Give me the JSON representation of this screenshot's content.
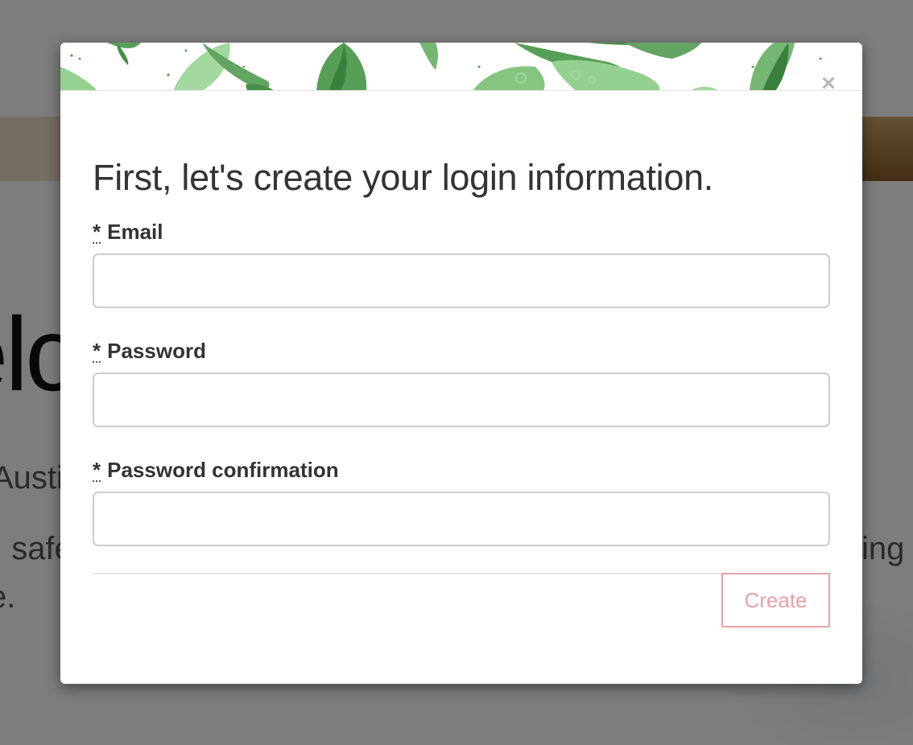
{
  "background": {
    "hero_text": "elc",
    "line_1": "Austin",
    "line_2": ", safe",
    "line_3": "e.",
    "line_4": "ing"
  },
  "modal": {
    "close_label": "×",
    "title": "First, let's create your login information.",
    "required_marker": "*",
    "fields": {
      "email": {
        "label": "Email",
        "value": "",
        "placeholder": ""
      },
      "password": {
        "label": "Password",
        "value": "",
        "placeholder": ""
      },
      "password_confirmation": {
        "label": "Password confirmation",
        "value": "",
        "placeholder": ""
      }
    },
    "create_label": "Create"
  },
  "colors": {
    "create_accent": "#e8a1a4",
    "backdrop": "rgba(0,0,0,0.5)",
    "leaf_green": "#5aa05a"
  }
}
